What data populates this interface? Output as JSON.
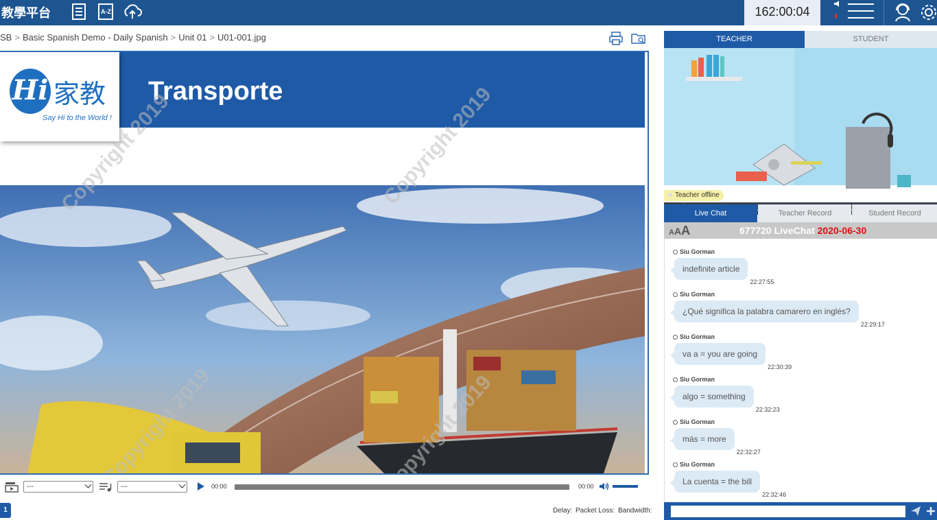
{
  "app": {
    "brand": "教學平台",
    "timer": "162:00:04"
  },
  "breadcrumb": [
    "SB",
    "Basic Spanish Demo - Daily Spanish",
    "Unit 01",
    "U01-001.jpg"
  ],
  "slide": {
    "title": "Transporte",
    "logo_hi": "Hi",
    "logo_cn": "家教",
    "logo_tagline": "Say Hi to the World !",
    "watermark": "Copyright 2019"
  },
  "player": {
    "select1": "---",
    "select2": "---",
    "time_current": "00:00",
    "time_total": "00:00"
  },
  "page_number": "1",
  "stats": {
    "delay": "Delay:",
    "packet_loss": "Packet Loss:",
    "bandwidth": "Bandwidth:"
  },
  "video_tabs": [
    {
      "label": "TEACHER",
      "active": true
    },
    {
      "label": "STUDENT",
      "active": false
    }
  ],
  "teacher_status": "Teacher offline",
  "chat_tabs": [
    {
      "label": "Live Chat",
      "active": true
    },
    {
      "label": "Teacher Record",
      "active": false
    },
    {
      "label": "Student Record",
      "active": false
    }
  ],
  "chat": {
    "font_size_label": "AAA",
    "room": "677720 LiveChat",
    "date": "2020-06-30",
    "messages": [
      {
        "sender": "Siu Gorman",
        "text": "indefinite article",
        "time": "22:27:55"
      },
      {
        "sender": "Siu Gorman",
        "text": "¿Qué significa la palabra camarero en inglés?",
        "time": "22:29:17"
      },
      {
        "sender": "Siu Gorman",
        "text": "va a = you are going",
        "time": "22:30:39"
      },
      {
        "sender": "Siu Gorman",
        "text": "algo = something",
        "time": "22:32:23"
      },
      {
        "sender": "Siu Gorman",
        "text": "más = more",
        "time": "22:32:27"
      },
      {
        "sender": "Siu Gorman",
        "text": "La cuenta = the bill",
        "time": "22:32:46"
      }
    ]
  },
  "colors": {
    "topbar": "#1d5591",
    "accent": "#1f5aa6",
    "chat_date": "#e01010",
    "bubble": "#dceaf5"
  }
}
